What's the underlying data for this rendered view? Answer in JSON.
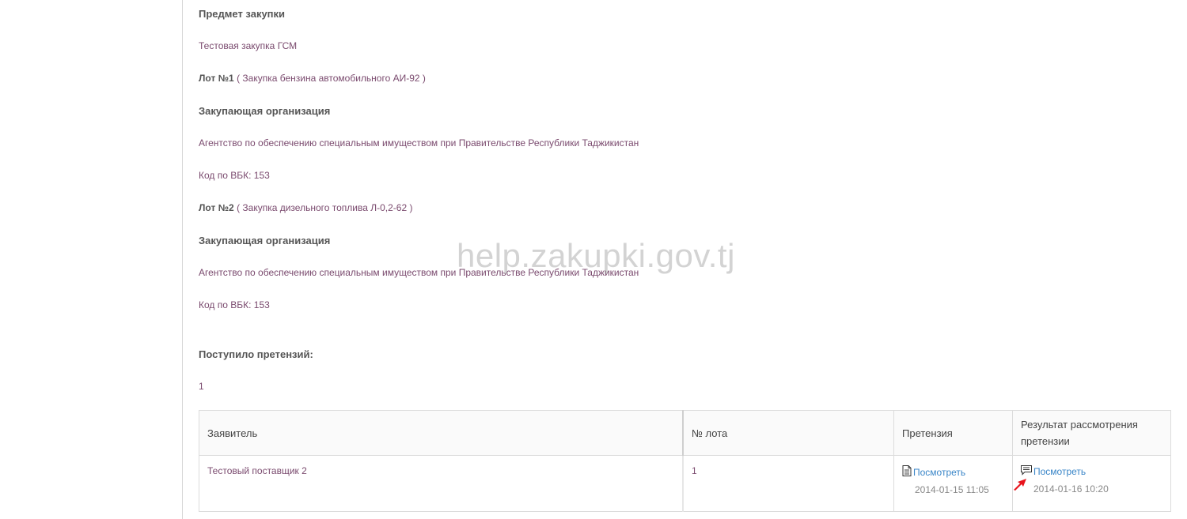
{
  "subject": {
    "heading": "Предмет закупки",
    "value": "Тестовая закупка ГСМ"
  },
  "lots": [
    {
      "label": "Лот №1",
      "desc": "( Закупка бензина автомобильного АИ-92 )",
      "org_heading": "Закупающая организация",
      "org_name": "Агентство по обеспечению специальным имуществом при Правительстве Республики Таджикистан",
      "vbk": "Код по ВБК: 153"
    },
    {
      "label": "Лот №2",
      "desc": "( Закупка дизельного топлива Л-0,2-62 )",
      "org_heading": "Закупающая организация",
      "org_name": "Агентство по обеспечению специальным имуществом при Правительстве Республики Таджикистан",
      "vbk": "Код по ВБК: 153"
    }
  ],
  "claims": {
    "heading": "Поступило претензий:",
    "count": "1",
    "columns": [
      "Заявитель",
      "№ лота",
      "Претензия",
      "Результат рассмотрения претензии"
    ],
    "rows": [
      {
        "applicant": "Тестовый поставщик 2",
        "lot": "1",
        "claim_link": "Посмотреть",
        "claim_date": "2014-01-15 11:05",
        "result_link": "Посмотреть",
        "result_date": "2014-01-16 10:20"
      }
    ]
  },
  "watermark": "help.zakupki.gov.tj",
  "icons": {
    "claim": "document-icon",
    "result": "comment-icon",
    "pointer": "red-arrow-icon"
  },
  "colors": {
    "text": "#7a4a6e",
    "link": "#3a86c8",
    "arrow": "#e8141c"
  }
}
